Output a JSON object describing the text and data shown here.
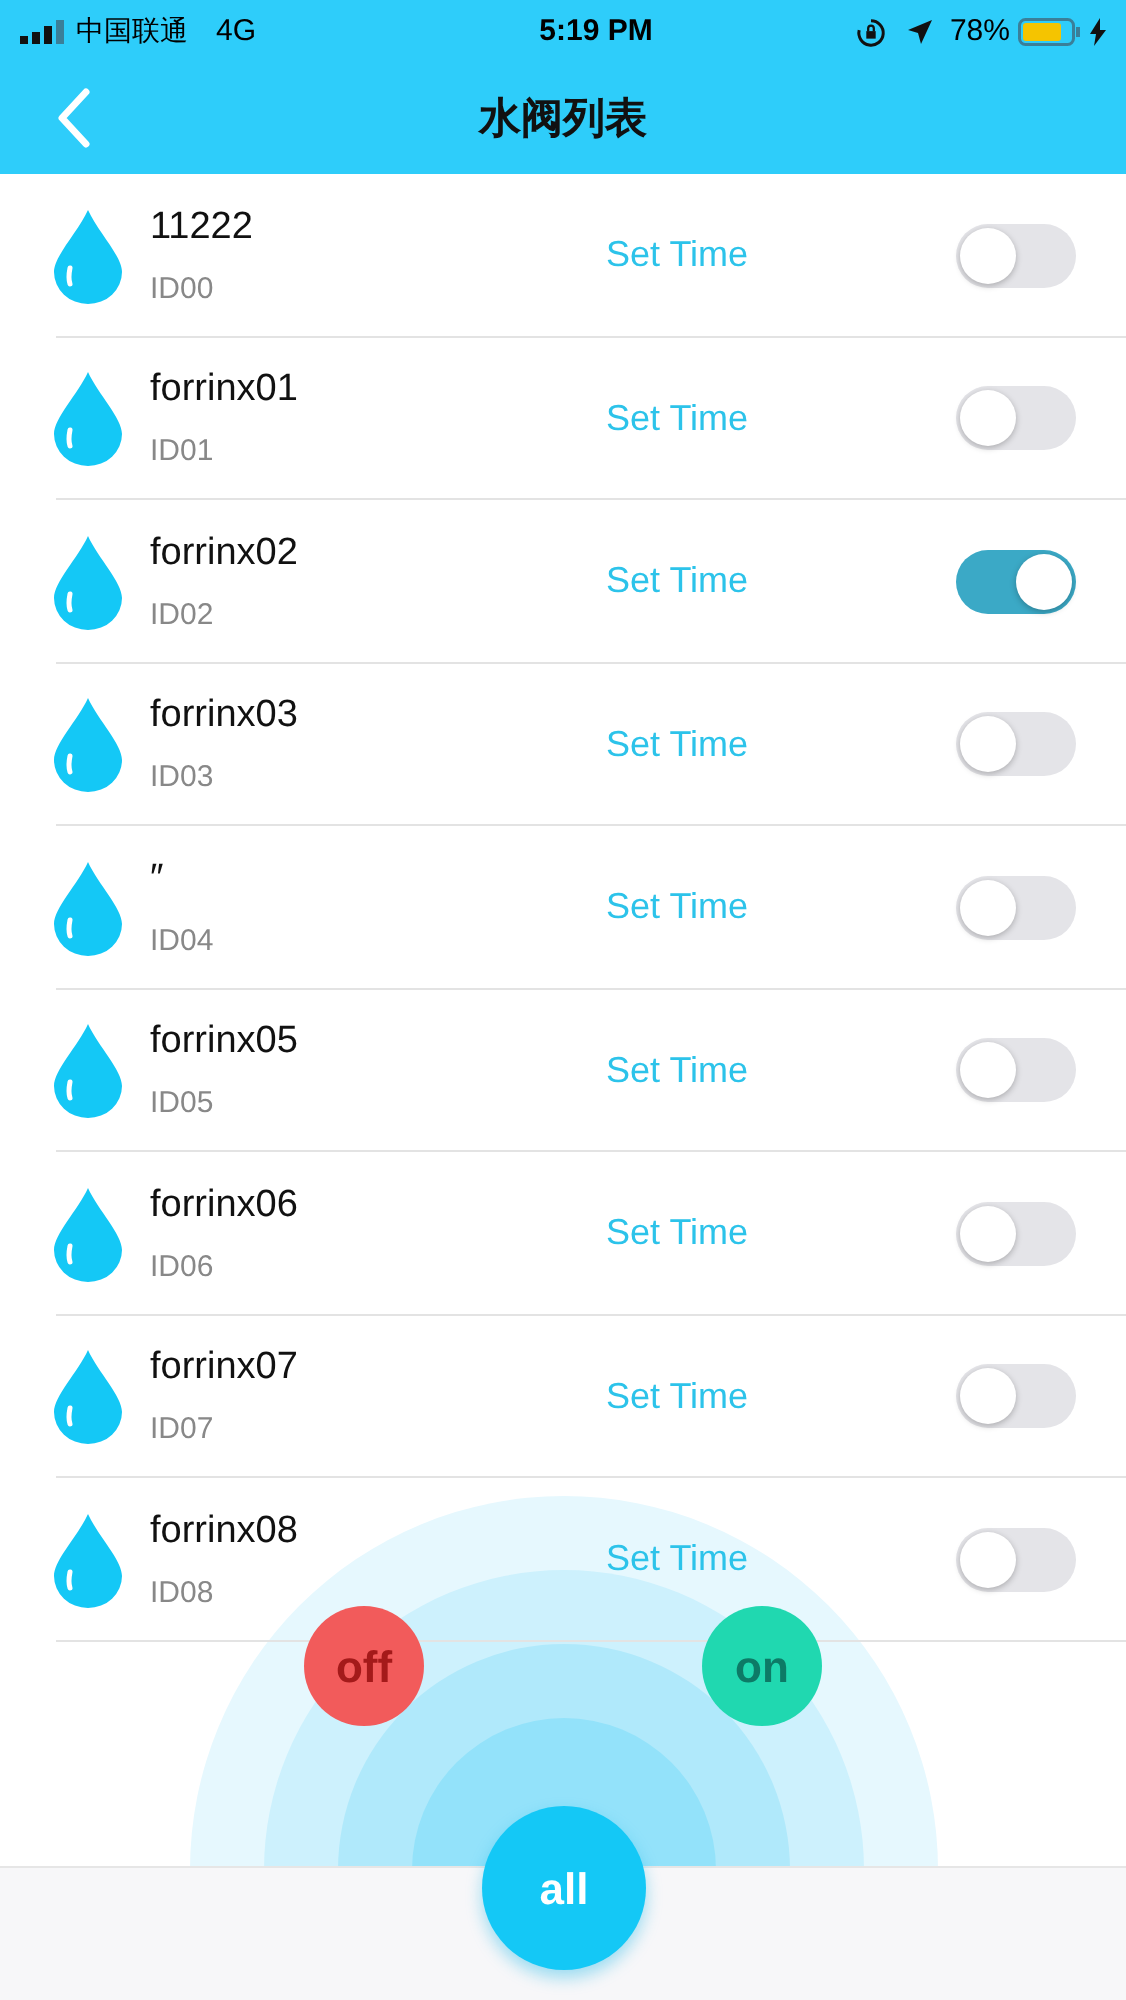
{
  "status_bar": {
    "carrier": "中国联通",
    "network": "4G",
    "time": "5:19 PM",
    "battery": "78%"
  },
  "nav": {
    "title": "水阀列表"
  },
  "valves": [
    {
      "name": "11222",
      "id": "ID00",
      "action": "Set Time",
      "on": false
    },
    {
      "name": "forrinx01",
      "id": "ID01",
      "action": "Set Time",
      "on": false
    },
    {
      "name": "forrinx02",
      "id": "ID02",
      "action": "Set Time",
      "on": true
    },
    {
      "name": "forrinx03",
      "id": "ID03",
      "action": "Set Time",
      "on": false
    },
    {
      "name": "″",
      "id": "ID04",
      "action": "Set Time",
      "on": false
    },
    {
      "name": "forrinx05",
      "id": "ID05",
      "action": "Set Time",
      "on": false
    },
    {
      "name": "forrinx06",
      "id": "ID06",
      "action": "Set Time",
      "on": false
    },
    {
      "name": "forrinx07",
      "id": "ID07",
      "action": "Set Time",
      "on": false
    },
    {
      "name": "forrinx08",
      "id": "ID08",
      "action": "Set Time",
      "on": false
    }
  ],
  "controls": {
    "off": "off",
    "on": "on",
    "all": "all"
  }
}
